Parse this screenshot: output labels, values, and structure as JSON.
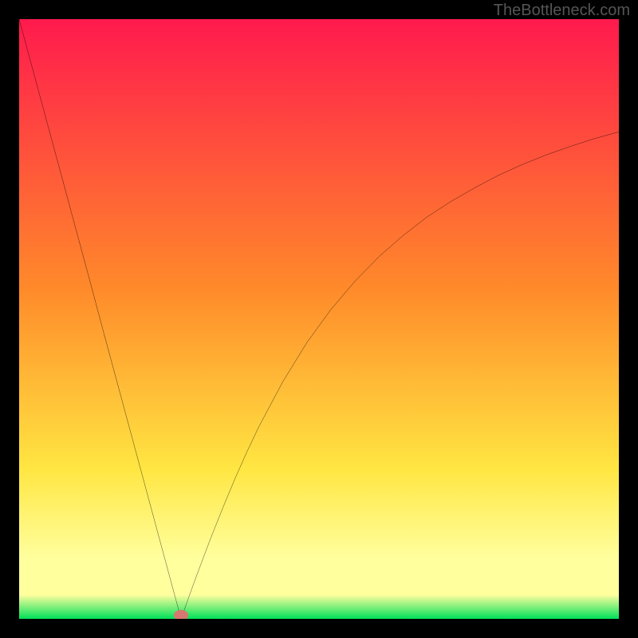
{
  "watermark": "TheBottleneck.com",
  "gradient": {
    "top": "#ff1a4d",
    "orange": "#ff8a2a",
    "yellow": "#ffe642",
    "pale": "#ffff9e",
    "green": "#00e05a"
  },
  "chart_data": {
    "type": "line",
    "title": "",
    "xlabel": "",
    "ylabel": "",
    "xlim": [
      0,
      100
    ],
    "ylim": [
      0,
      100
    ],
    "minimum_x": 27,
    "series": [
      {
        "name": "curve",
        "x": [
          0,
          2,
          4,
          6,
          8,
          10,
          12,
          14,
          16,
          18,
          20,
          22,
          24,
          25,
          26,
          27,
          28,
          29,
          30,
          32,
          34,
          36,
          38,
          40,
          44,
          48,
          52,
          56,
          60,
          64,
          68,
          72,
          76,
          80,
          84,
          88,
          92,
          96,
          100
        ],
        "values": [
          100,
          92.6,
          85.2,
          77.8,
          70.4,
          63.0,
          55.6,
          48.1,
          40.7,
          33.3,
          25.9,
          18.5,
          11.1,
          7.4,
          3.7,
          0,
          2.8,
          5.6,
          8.3,
          13.6,
          18.6,
          23.4,
          27.9,
          32.1,
          39.6,
          46.1,
          51.6,
          56.3,
          60.4,
          63.9,
          67.0,
          69.6,
          71.9,
          74.0,
          75.8,
          77.4,
          78.8,
          80.1,
          81.2
        ]
      }
    ],
    "marker": {
      "x": 27,
      "y": 0,
      "color": "#d6786f"
    }
  }
}
